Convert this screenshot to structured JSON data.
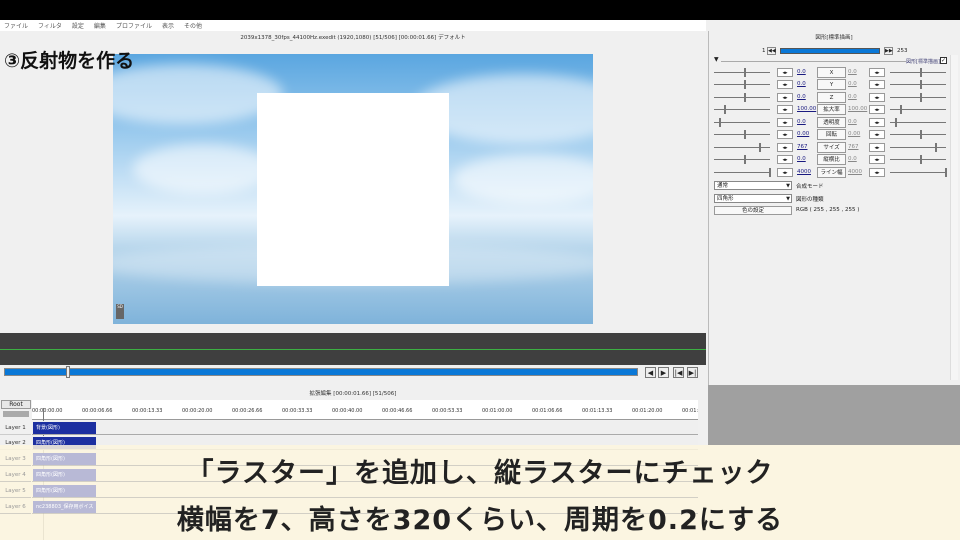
{
  "menu": [
    "ファイル",
    "フィルタ",
    "設定",
    "編集",
    "プロファイル",
    "表示",
    "その他"
  ],
  "main_title": "2039x1378_30fps_44100Hz.exedit (1920,1080)  [51/506] [00:00:01.66]  デフォルト",
  "heading": "③反射物を作る",
  "preview_badge": "SD",
  "timeline": {
    "title": "拡張編集 [00:00:01.66] [51/506]",
    "root": "Root",
    "ticks": [
      "00:00:00.00",
      "00:00:06.66",
      "00:00:13.33",
      "00:00:20.00",
      "00:00:26.66",
      "00:00:33.33",
      "00:00:40.00",
      "00:00:46.66",
      "00:00:53.33",
      "00:01:00.00",
      "00:01:06.66",
      "00:01:13.33",
      "00:01:20.00",
      "00:01:"
    ],
    "layers": [
      {
        "label": "Layer 1",
        "clip": "背景(図形)"
      },
      {
        "label": "Layer 2",
        "clip": "四角形(図形)"
      },
      {
        "label": "Layer 3",
        "clip": "四角形(図形)"
      },
      {
        "label": "Layer 4",
        "clip": "四角形(図形)"
      },
      {
        "label": "Layer 5",
        "clip": "四角形(図形)"
      },
      {
        "label": "Layer 6",
        "clip": "nc238803_保存用ボイス"
      }
    ],
    "playback": [
      "◀",
      "▶",
      "|◀",
      "▶|"
    ]
  },
  "panel": {
    "title": "図形[標準描画]",
    "frame_start": "1",
    "frame_end": "253",
    "object_label": "図形[標準描画]",
    "params": [
      {
        "name": "X",
        "v1": "0.0",
        "v2": "0.0"
      },
      {
        "name": "Y",
        "v1": "0.0",
        "v2": "0.0"
      },
      {
        "name": "Z",
        "v1": "0.0",
        "v2": "0.0"
      },
      {
        "name": "拡大率",
        "v1": "100.00",
        "v2": "100.00"
      },
      {
        "name": "透明度",
        "v1": "0.0",
        "v2": "0.0"
      },
      {
        "name": "回転",
        "v1": "0.00",
        "v2": "0.00"
      },
      {
        "name": "サイズ",
        "v1": "767",
        "v2": "767"
      },
      {
        "name": "縦横比",
        "v1": "0.0",
        "v2": "0.0"
      },
      {
        "name": "ライン幅",
        "v1": "4000",
        "v2": "4000"
      }
    ],
    "blend_mode": "通常",
    "blend_label": "合成モード",
    "shape": "四角形",
    "shape_label": "図形の種類",
    "color_button": "色の設定",
    "color_value": "RGB ( 255 , 255 , 255 )"
  },
  "subtitle": {
    "line1": "「ラスター」を追加し、縦ラスターにチェック",
    "line2": "横幅を7、高さを320くらい、周期を0.2にする"
  }
}
